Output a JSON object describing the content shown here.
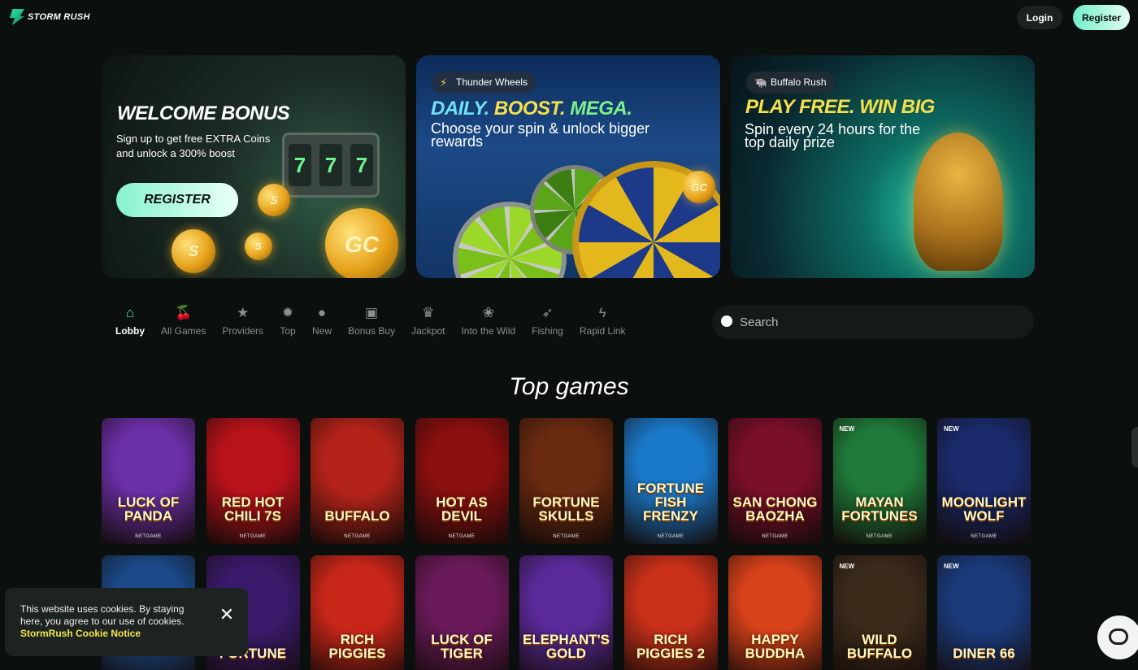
{
  "header": {
    "logo_text": "STORM RUSH",
    "login_label": "Login",
    "register_label": "Register"
  },
  "banners": [
    {
      "title": "WELCOME BONUS",
      "subtitle": "Sign up to get free EXTRA Coins and unlock a 300% boost",
      "button_label": "REGISTER",
      "slot_symbols": [
        "7",
        "7",
        "7"
      ],
      "coin_labels": [
        "GC",
        "S",
        "S",
        "S"
      ]
    },
    {
      "pill_label": "Thunder Wheels",
      "title_parts": [
        "DAILY.",
        "BOOST.",
        "MEGA."
      ],
      "subtitle": "Choose your spin & unlock bigger rewards",
      "coin_label": "GC"
    },
    {
      "pill_label": "Buffalo Rush",
      "title": "PLAY FREE. WIN BIG",
      "subtitle": "Spin every 24 hours for the top daily prize"
    }
  ],
  "nav": [
    {
      "label": "Lobby",
      "icon": "home-icon",
      "active": true
    },
    {
      "label": "All Games",
      "icon": "cherries-icon"
    },
    {
      "label": "Providers",
      "icon": "star-icon"
    },
    {
      "label": "Top",
      "icon": "badge-icon"
    },
    {
      "label": "New",
      "icon": "new-icon"
    },
    {
      "label": "Bonus Buy",
      "icon": "gift-icon"
    },
    {
      "label": "Jackpot",
      "icon": "trophy-icon"
    },
    {
      "label": "Into the Wild",
      "icon": "paw-icon"
    },
    {
      "label": "Fishing",
      "icon": "fish-icon"
    },
    {
      "label": "Rapid Link",
      "icon": "lightning-icon"
    }
  ],
  "search": {
    "placeholder": "Search"
  },
  "section_title": "Top games",
  "games": [
    {
      "name": "LUCK OF PANDA",
      "provider": "NETGAME",
      "badge": ""
    },
    {
      "name": "RED HOT CHILI 7s",
      "provider": "NETGAME",
      "badge": ""
    },
    {
      "name": "BUFFALO",
      "provider": "NETGAME",
      "badge": ""
    },
    {
      "name": "HOT AS DEVIL",
      "provider": "NETGAME",
      "badge": ""
    },
    {
      "name": "FORTUNE SKULLS",
      "provider": "NETGAME",
      "badge": ""
    },
    {
      "name": "FORTUNE FISH FRENZY",
      "provider": "NETGAME",
      "badge": ""
    },
    {
      "name": "SAN CHONG BAOZHA",
      "provider": "NETGAME",
      "badge": ""
    },
    {
      "name": "MAYAN FORTUNES",
      "provider": "NETGAME",
      "badge": "NEW"
    },
    {
      "name": "MOONLIGHT WOLF",
      "provider": "NETGAME",
      "badge": "NEW"
    },
    {
      "name": "",
      "provider": "",
      "badge": ""
    },
    {
      "name": "FORTUNE",
      "provider": "",
      "badge": ""
    },
    {
      "name": "RICH PIGGIES",
      "provider": "",
      "badge": ""
    },
    {
      "name": "LUCK OF TIGER",
      "provider": "",
      "badge": ""
    },
    {
      "name": "ELEPHANT'S GOLD",
      "provider": "",
      "badge": ""
    },
    {
      "name": "RICH PIGGIES 2",
      "provider": "",
      "badge": ""
    },
    {
      "name": "HAPPY BUDDHA",
      "provider": "",
      "badge": ""
    },
    {
      "name": "WILD BUFFALO",
      "provider": "",
      "badge": "NEW"
    },
    {
      "name": "DINER 66",
      "provider": "",
      "badge": "NEW"
    }
  ],
  "game_colors": [
    "#6b2fa8",
    "#b8121a",
    "#b3231a",
    "#8a0f0f",
    "#6a2a10",
    "#1a78c8",
    "#7a0f2a",
    "#1f7a3a",
    "#1a2a6a",
    "#1a4a8a",
    "#3a1a6a",
    "#c9261a",
    "#6a1a5a",
    "#5a2a9a",
    "#c8301a",
    "#d8421a",
    "#3a2a1a",
    "#1a3a7a"
  ],
  "cookie": {
    "text": "This website uses cookies. By staying here, you agree to our use of cookies.",
    "link": "StormRush Cookie Notice",
    "close": "✕"
  }
}
